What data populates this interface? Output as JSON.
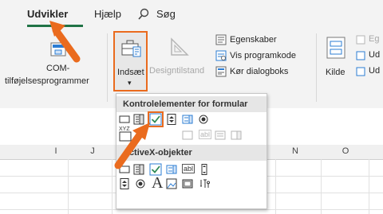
{
  "tabs": [
    "Udvikler",
    "Hjælp",
    "Søg"
  ],
  "ribbon": {
    "com_label_1": "COM-",
    "com_label_2": "tilføjelsesprogrammer",
    "insert_label": "Indsæt",
    "insert_arrow": "▾",
    "design_label": "Designtilstand",
    "properties": "Egenskaber",
    "view_code": "Vis programkode",
    "run_dialog": "Kør dialogboks",
    "source": "Kilde",
    "xml_1": "Eg",
    "xml_2": "Ud",
    "xml_3": "Ud"
  },
  "dropdown": {
    "form_controls_title": "Kontrolelementer for formular",
    "activex_title": "ActiveX-objekter",
    "xyz_label": "XYZ",
    "abl_label": "abl",
    "a_label": "A"
  },
  "columns": [
    "I",
    "J",
    "N",
    "O"
  ],
  "colors": {
    "accent_green": "#217346",
    "highlight_orange": "#ea6b1e"
  }
}
